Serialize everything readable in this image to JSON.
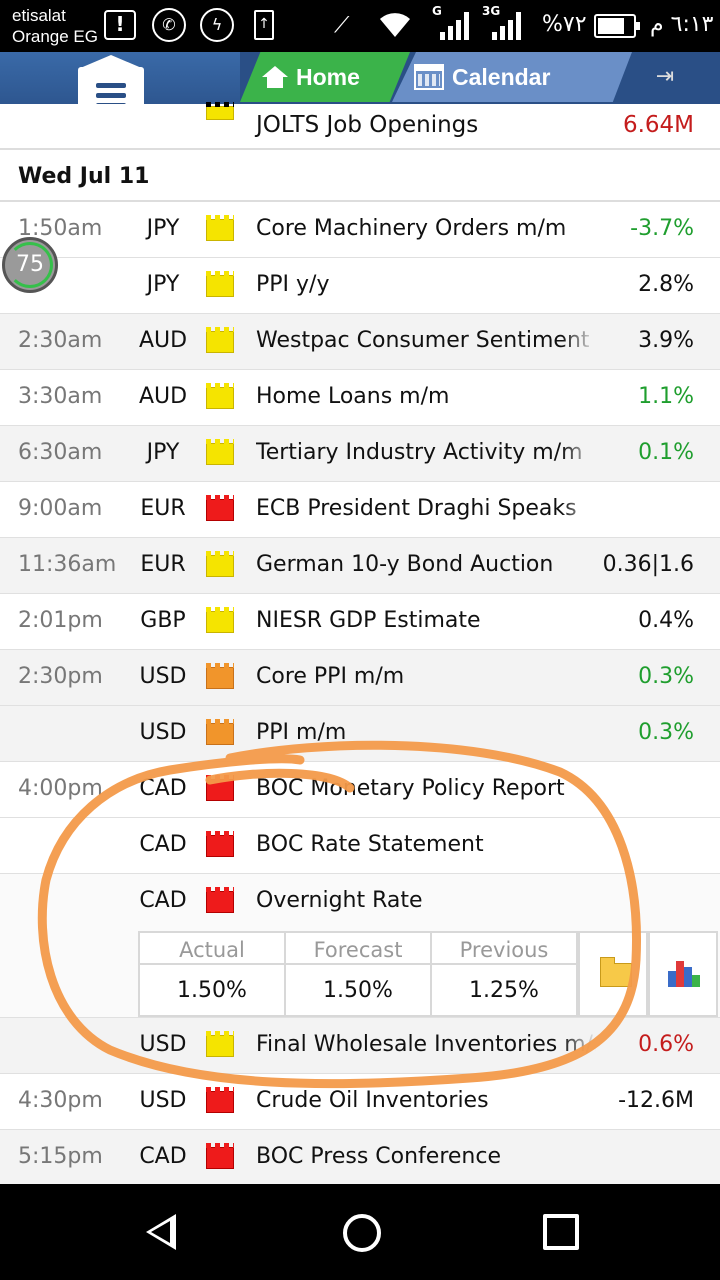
{
  "status_bar": {
    "carrier_line1": "etisalat",
    "carrier_line2": "Orange EG",
    "battery_text": "%٧٢",
    "time": "٦:١٣ م",
    "net1": "G",
    "net2": "3G"
  },
  "header": {
    "tabs": [
      {
        "label": "Home",
        "icon": "home-icon",
        "active": true
      },
      {
        "label": "Calendar",
        "icon": "calendar-icon",
        "active": false
      }
    ]
  },
  "top_row": {
    "event": "JOLTS Job Openings",
    "value": "6.64M",
    "value_color": "#c41c1c"
  },
  "date_header": "Wed Jul 11",
  "badge": "75",
  "rows": [
    {
      "time": "1:50am",
      "currency": "JPY",
      "impact": "low",
      "event": "Core Machinery Orders m/m",
      "value": "-3.7%",
      "tone": "pos",
      "shade": "grp"
    },
    {
      "time": "",
      "currency": "JPY",
      "impact": "low",
      "event": "PPI y/y",
      "value": "2.8%",
      "tone": "neu",
      "shade": "grp"
    },
    {
      "time": "2:30am",
      "currency": "AUD",
      "impact": "low",
      "event": "Westpac Consumer Sentiment",
      "value": "3.9%",
      "tone": "neu",
      "shade": "grp-alt"
    },
    {
      "time": "3:30am",
      "currency": "AUD",
      "impact": "low",
      "event": "Home Loans m/m",
      "value": "1.1%",
      "tone": "pos",
      "shade": "grp"
    },
    {
      "time": "6:30am",
      "currency": "JPY",
      "impact": "low",
      "event": "Tertiary Industry Activity m/m",
      "value": "0.1%",
      "tone": "pos",
      "shade": "grp-alt"
    },
    {
      "time": "9:00am",
      "currency": "EUR",
      "impact": "high",
      "event": "ECB President Draghi Speaks",
      "value": "",
      "tone": "neu",
      "shade": "grp"
    },
    {
      "time": "11:36am",
      "currency": "EUR",
      "impact": "low",
      "event": "German 10-y Bond Auction",
      "value": "0.36|1.6",
      "tone": "neu",
      "shade": "grp-alt"
    },
    {
      "time": "2:01pm",
      "currency": "GBP",
      "impact": "low",
      "event": "NIESR GDP Estimate",
      "value": "0.4%",
      "tone": "neu",
      "shade": "grp"
    },
    {
      "time": "2:30pm",
      "currency": "USD",
      "impact": "med",
      "event": "Core PPI m/m",
      "value": "0.3%",
      "tone": "pos",
      "shade": "grp-alt"
    },
    {
      "time": "",
      "currency": "USD",
      "impact": "med",
      "event": "PPI m/m",
      "value": "0.3%",
      "tone": "pos",
      "shade": "grp-alt"
    },
    {
      "time": "4:00pm",
      "currency": "CAD",
      "impact": "high",
      "event": "BOC Monetary Policy Report",
      "value": "",
      "tone": "neu",
      "shade": "grp"
    },
    {
      "time": "",
      "currency": "CAD",
      "impact": "high",
      "event": "BOC Rate Statement",
      "value": "",
      "tone": "neu",
      "shade": "grp"
    },
    {
      "time": "",
      "currency": "CAD",
      "impact": "high",
      "event": "Overnight Rate",
      "value": "",
      "tone": "neu",
      "shade": "selected"
    }
  ],
  "detail": {
    "headers": [
      "Actual",
      "Forecast",
      "Previous"
    ],
    "values": [
      "1.50%",
      "1.50%",
      "1.25%"
    ],
    "buttons": [
      "folder-icon",
      "bar-chart-icon"
    ]
  },
  "rows_after": [
    {
      "time": "",
      "currency": "USD",
      "impact": "low",
      "event": "Final Wholesale Inventories m/m",
      "value": "0.6%",
      "tone": "neg",
      "shade": "grp-alt"
    },
    {
      "time": "4:30pm",
      "currency": "USD",
      "impact": "high",
      "event": "Crude Oil Inventories",
      "value": "-12.6M",
      "tone": "neu",
      "shade": "grp"
    },
    {
      "time": "5:15pm",
      "currency": "CAD",
      "impact": "high",
      "event": "BOC Press Conference",
      "value": "",
      "tone": "neu",
      "shade": "grp-alt"
    }
  ],
  "colors": {
    "header_blue": "#2a4f86",
    "tab_green": "#3bb34a",
    "positive": "#1f9e2e",
    "negative": "#c41c1c",
    "annotation": "#f39a4a"
  }
}
